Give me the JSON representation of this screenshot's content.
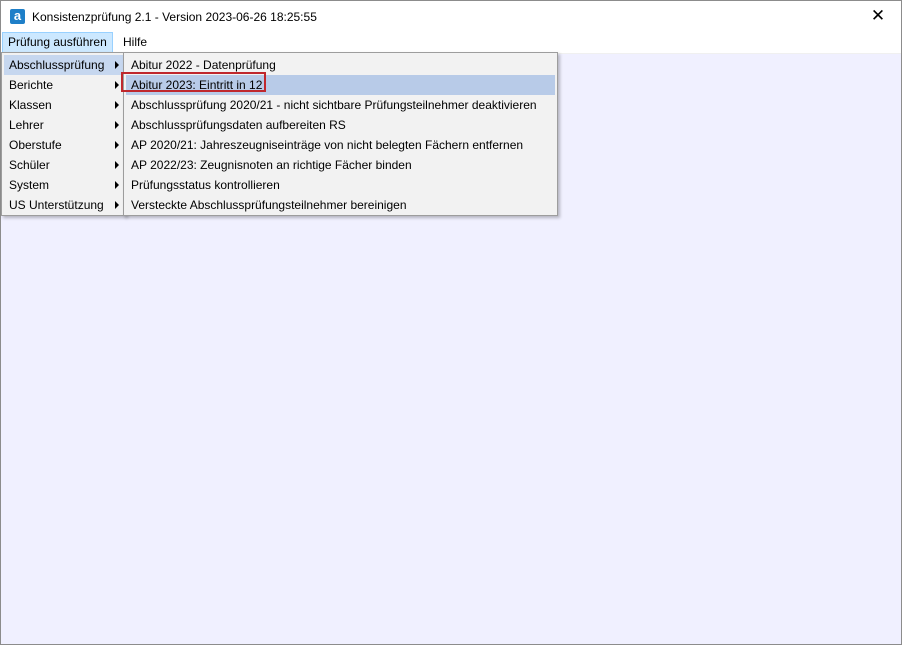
{
  "window": {
    "title": "Konsistenzprüfung 2.1 - Version 2023-06-26 18:25:55",
    "close_glyph": "✕",
    "app_icon_glyph": "a"
  },
  "menubar": {
    "items": [
      "Prüfung ausführen",
      "Hilfe"
    ]
  },
  "main_menu": {
    "items": [
      "Abschlussprüfung",
      "Berichte",
      "Klassen",
      "Lehrer",
      "Oberstufe",
      "Schüler",
      "System",
      "US Unterstützung"
    ]
  },
  "submenu": {
    "items": [
      "Abitur 2022 - Datenprüfung",
      "Abitur 2023: Eintritt in 12",
      "Abschlussprüfung 2020/21 - nicht sichtbare Prüfungsteilnehmer deaktivieren",
      "Abschlussprüfungsdaten aufbereiten RS",
      "AP 2020/21: Jahreszeugniseinträge von nicht belegten Fächern entfernen",
      "AP 2022/23: Zeugnisnoten an richtige Fächer binden",
      "Prüfungsstatus kontrollieren",
      "Versteckte Abschlussprüfungsteilnehmer bereinigen"
    ]
  },
  "colors": {
    "accent": "#1e7fc8",
    "highlight": "#c6d7ef",
    "annotation": "#c0282d",
    "client_bg": "#f0f0ff"
  }
}
